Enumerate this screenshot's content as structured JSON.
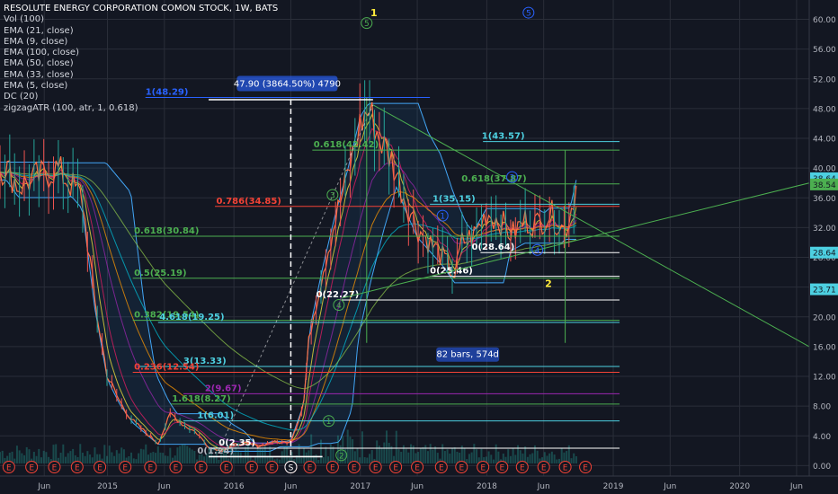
{
  "legend": {
    "title": "RESOLUTE ENERGY CORPORATION COMON STOCK, 1W, BATS",
    "indicators": [
      "Vol (100)",
      "EMA (21, close)",
      "EMA (9, close)",
      "EMA (100, close)",
      "EMA (50, close)",
      "EMA (33, close)",
      "EMA (5, close)",
      "DC (20)",
      "zigzagATR (100, atr, 1, 0.618)"
    ]
  },
  "colors": {
    "background": "#131722",
    "axis_text": "#b2b5be",
    "grid": "#2a2e39",
    "white": "#ffffff",
    "green": "#4caf50",
    "cyan": "#4dd0e1",
    "red": "#f44336",
    "purple": "#9c27b0",
    "yellow": "#ffeb3b",
    "blue_badge": "#2962ff",
    "dc_band": "#42a5f5",
    "volume": "#26a69a"
  },
  "chart_data": {
    "type": "line",
    "ylim": [
      -1.4,
      62.6
    ],
    "y_ticks": [
      0,
      4,
      8,
      12,
      16,
      20,
      24,
      28,
      32,
      36,
      40,
      44,
      48,
      52,
      56,
      60
    ],
    "y_tick_labels": [
      "0.00",
      "4.00",
      "8.00",
      "12.00",
      "16.00",
      "20.00",
      "24.00",
      "28.00",
      "32.00",
      "36.00",
      "40.00",
      "44.00",
      "48.00",
      "52.00",
      "56.00",
      "60.00"
    ],
    "x_labels": [
      {
        "t": 2014.5,
        "label": "Jun"
      },
      {
        "t": 2015.0,
        "label": "2015"
      },
      {
        "t": 2015.45,
        "label": "Jun"
      },
      {
        "t": 2016.0,
        "label": "2016"
      },
      {
        "t": 2016.45,
        "label": "Jun"
      },
      {
        "t": 2017.0,
        "label": "2017"
      },
      {
        "t": 2017.45,
        "label": "Jun"
      },
      {
        "t": 2018.0,
        "label": "2018"
      },
      {
        "t": 2018.45,
        "label": "Jun"
      },
      {
        "t": 2019.0,
        "label": "2019"
      },
      {
        "t": 2019.45,
        "label": "Jun"
      },
      {
        "t": 2020.0,
        "label": "2020"
      },
      {
        "t": 2020.45,
        "label": "Jun"
      }
    ],
    "price_badges": [
      {
        "value": 38.64,
        "label": "38.64",
        "color": "#4dd0e1"
      },
      {
        "value": 37.8,
        "label": "38.54",
        "color": "#4caf50"
      },
      {
        "value": 28.64,
        "label": "28.64",
        "color": "#4dd0e1"
      },
      {
        "value": 23.71,
        "label": "23.71",
        "color": "#4dd0e1"
      }
    ],
    "series": [
      {
        "x": [
          2014.2,
          2014.3,
          2014.4,
          2014.5,
          2014.6,
          2014.7,
          2014.8,
          2014.9,
          2015.0,
          2015.1,
          2015.2,
          2015.3,
          2015.4,
          2015.5,
          2015.6,
          2015.7,
          2015.8,
          2015.9,
          2016.0,
          2016.1,
          2016.2,
          2016.3,
          2016.38,
          2016.45,
          2016.55,
          2016.6,
          2016.7,
          2016.8,
          2016.9,
          2017.0,
          2017.07,
          2017.15,
          2017.25,
          2017.35,
          2017.45,
          2017.55,
          2017.65,
          2017.75,
          2017.8,
          2017.9,
          2018.0,
          2018.1,
          2018.2,
          2018.3,
          2018.4,
          2018.5,
          2018.55,
          2018.62,
          2018.66,
          2018.72
        ],
        "values": [
          40.0,
          37.5,
          38.5,
          39.0,
          40.0,
          38.0,
          36.0,
          22.0,
          12.0,
          8.5,
          6.0,
          4.5,
          3.0,
          7.0,
          5.5,
          4.5,
          2.5,
          2.0,
          2.8,
          3.0,
          2.6,
          3.2,
          3.1,
          3.3,
          8.0,
          18.0,
          26.0,
          33.0,
          39.0,
          46.0,
          47.9,
          44.0,
          41.0,
          36.0,
          32.0,
          30.0,
          28.0,
          25.5,
          30.0,
          31.0,
          34.0,
          33.0,
          31.0,
          33.0,
          32.5,
          34.0,
          33.0,
          31.5,
          34.0,
          38.6
        ]
      }
    ]
  },
  "fibs": [
    {
      "value": 49.5,
      "label": "1(48.29)",
      "color": "#2962ff",
      "t1": 2015.3,
      "t2": 2017.55,
      "lx": 2015.3
    },
    {
      "value": 42.42,
      "label": "0.618(42.42)",
      "color": "#4caf50",
      "t1": 2016.62,
      "t2": 2019.05,
      "lx": 2016.63
    },
    {
      "value": 34.85,
      "label": "0.786(34.85)",
      "color": "#f44336",
      "t1": 2015.85,
      "t2": 2019.05,
      "lx": 2015.86
    },
    {
      "value": 30.84,
      "label": "0.618(30.84)",
      "color": "#4caf50",
      "t1": 2015.2,
      "t2": 2019.05,
      "lx": 2015.21
    },
    {
      "value": 25.19,
      "label": "0.5(25.19)",
      "color": "#4caf50",
      "t1": 2015.2,
      "t2": 2019.05,
      "lx": 2015.21
    },
    {
      "value": 19.54,
      "label": "0.382(19.54)",
      "color": "#4caf50",
      "t1": 2015.2,
      "t2": 2019.05,
      "lx": 2015.21
    },
    {
      "value": 19.25,
      "label": "4.618(19.25)",
      "color": "#4dd0e1",
      "t1": 2015.4,
      "t2": 2019.05,
      "lx": 2015.41
    },
    {
      "value": 13.33,
      "label": "3(13.33)",
      "color": "#4dd0e1",
      "t1": 2015.25,
      "t2": 2019.05,
      "lx": 2015.6
    },
    {
      "value": 12.54,
      "label": "0.236(12.54)",
      "color": "#f44336",
      "t1": 2015.2,
      "t2": 2019.05,
      "lx": 2015.21
    },
    {
      "value": 9.67,
      "label": "2(9.67)",
      "color": "#9c27b0",
      "t1": 2015.6,
      "t2": 2019.05,
      "lx": 2015.77
    },
    {
      "value": 8.27,
      "label": "1.618(8.27)",
      "color": "#4caf50",
      "t1": 2015.5,
      "t2": 2019.05,
      "lx": 2015.51
    },
    {
      "value": 6.01,
      "label": "1(6.01)",
      "color": "#4dd0e1",
      "t1": 2015.6,
      "t2": 2019.05,
      "lx": 2015.71
    },
    {
      "value": 2.35,
      "label": "0(2.35)",
      "color": "#ffffff",
      "t1": 2015.8,
      "t2": 2019.05,
      "lx": 2015.88
    },
    {
      "value": 1.24,
      "label": "0(1.24)",
      "color": "#b2b5be",
      "t1": 2015.8,
      "t2": 2016.7,
      "lx": 2015.71
    },
    {
      "value": 43.57,
      "label": "1(43.57)",
      "color": "#4dd0e1",
      "t1": 2017.97,
      "t2": 2019.05,
      "lx": 2017.96
    },
    {
      "value": 37.87,
      "label": "0.618(37.87)",
      "color": "#4caf50",
      "t1": 2018.0,
      "t2": 2019.05,
      "lx": 2017.8
    },
    {
      "value": 35.15,
      "label": "1(35.15)",
      "color": "#4dd0e1",
      "t1": 2017.55,
      "t2": 2019.05,
      "lx": 2017.57
    },
    {
      "value": 28.64,
      "label": "0(28.64)",
      "color": "#ffffff",
      "t1": 2017.95,
      "t2": 2019.05,
      "lx": 2017.88
    },
    {
      "value": 25.46,
      "label": "0(25.46)",
      "color": "#ffffff",
      "t1": 2017.55,
      "t2": 2019.05,
      "lx": 2017.55
    },
    {
      "value": 22.27,
      "label": "0(22.27)",
      "color": "#ffffff",
      "t1": 2016.85,
      "t2": 2019.05,
      "lx": 2016.65
    }
  ],
  "annotations": {
    "range_label": "47.90 (3864.50%) 4790",
    "bars_label": "82 bars, 574d",
    "wave_circles": [
      {
        "t": 2016.85,
        "v": 1.4,
        "label": "2",
        "color": "#4caf50"
      },
      {
        "t": 2016.75,
        "v": 6.0,
        "label": "1",
        "color": "#4caf50"
      },
      {
        "t": 2016.78,
        "v": 36.4,
        "label": "3",
        "color": "#4caf50"
      },
      {
        "t": 2016.83,
        "v": 21.6,
        "label": "4",
        "color": "#4caf50"
      },
      {
        "t": 2017.05,
        "v": 59.5,
        "label": "5",
        "color": "#4caf50"
      },
      {
        "t": 2017.65,
        "v": 33.6,
        "label": "1",
        "color": "#2962ff"
      },
      {
        "t": 2018.2,
        "v": 38.8,
        "label": "3",
        "color": "#2962ff"
      },
      {
        "t": 2018.4,
        "v": 29.0,
        "label": "4",
        "color": "#2962ff"
      },
      {
        "t": 2018.33,
        "v": 60.9,
        "label": "5",
        "color": "#2962ff"
      }
    ],
    "wave_labels": [
      {
        "t": 2017.08,
        "v": 60.4,
        "label": "1",
        "color": "#ffeb3b"
      },
      {
        "t": 2018.46,
        "v": 24.0,
        "label": "2",
        "color": "#ffeb3b"
      }
    ],
    "earnings_letter": "E",
    "split_letter": "S",
    "earnings_t": [
      2014.05,
      2014.22,
      2014.4,
      2014.58,
      2014.76,
      2014.94,
      2015.14,
      2015.34,
      2015.54,
      2015.74,
      2015.94,
      2016.14,
      2016.3,
      2016.45,
      2016.6,
      2016.78,
      2016.95,
      2017.12,
      2017.28,
      2017.45,
      2017.64,
      2017.8,
      2017.97,
      2018.12,
      2018.28,
      2018.45,
      2018.62,
      2018.78
    ]
  }
}
